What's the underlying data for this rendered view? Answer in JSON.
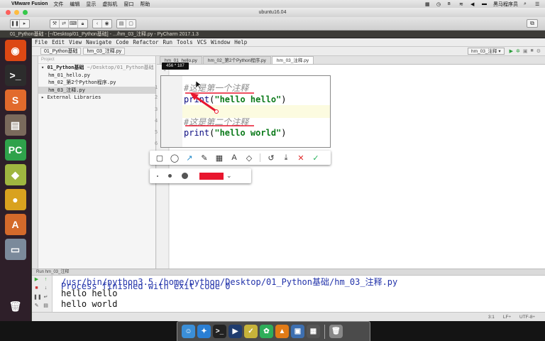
{
  "mac_menubar": {
    "app_name": "VMware Fusion",
    "menus": [
      "文件",
      "编辑",
      "显示",
      "虚拟机",
      "窗口",
      "帮助"
    ],
    "user_name": "黑马程序员"
  },
  "vm_window": {
    "title": "ubuntu16.04"
  },
  "ubuntu": {
    "window_title": "01_Python基础 - [~/Desktop/01_Python基础] - .../hm_03_注释.py - PyCharm 2017.1.3",
    "launcher": [
      {
        "name": "ubuntu-dash",
        "glyph": "◉",
        "color": "#dd4814"
      },
      {
        "name": "terminal",
        "glyph": ">_",
        "color": "#2c2c2c"
      },
      {
        "name": "sublime",
        "glyph": "S",
        "color": "#e26a2c"
      },
      {
        "name": "files",
        "glyph": "▤",
        "color": "#7a6a5c"
      },
      {
        "name": "pycharm",
        "glyph": "PC",
        "color": "#2fa24b"
      },
      {
        "name": "cube",
        "glyph": "◆",
        "color": "#9fb640"
      },
      {
        "name": "chrome",
        "glyph": "●",
        "color": "#d9a21f"
      },
      {
        "name": "text",
        "glyph": "A",
        "color": "#d46a2b"
      },
      {
        "name": "storage",
        "glyph": "▭",
        "color": "#7b8a9b"
      }
    ],
    "trash_glyph": "🗑"
  },
  "pycharm": {
    "menu": [
      "File",
      "Edit",
      "View",
      "Navigate",
      "Code",
      "Refactor",
      "Run",
      "Tools",
      "VCS",
      "Window",
      "Help"
    ],
    "breadcrumbs": [
      "01_Python基础",
      "hm_03_注释.py"
    ],
    "run_config": "hm_03_注释 ▾",
    "project_header": "Project",
    "tree": [
      {
        "label": "01_Python基础",
        "path": " ~/Desktop/01_Python基础"
      },
      {
        "label": "hm_01_hello.py",
        "path": ""
      },
      {
        "label": "hm_02_第2个Python程序.py",
        "path": ""
      },
      {
        "label": "hm_03_注释.py",
        "path": ""
      },
      {
        "label": "External Libraries",
        "path": ""
      }
    ],
    "tabs": [
      "hm_01_hello.py",
      "hm_02_第2个Python程序.py",
      "hm_03_注释.py"
    ],
    "line_numbers": [
      "1",
      "2",
      "3",
      "4",
      "5",
      "6"
    ],
    "run_header": "Run   hm_03_注释",
    "console": {
      "command": "/usr/bin/python3.5 /home/python/Desktop/01_Python基础/hm_03_注释.py",
      "out1": "hello hello",
      "out2": "hello world",
      "exit": "Process finished with exit code 0"
    },
    "status": {
      "position": "3:1",
      "separator": "LF÷",
      "encoding": "UTF-8÷"
    }
  },
  "overlay": {
    "size_label": "456 * 187",
    "code": {
      "comment1": "#这是第一个注释",
      "line2_fn": "print",
      "line2_arg": "\"hello hello\"",
      "comment2": "#这是第二个注释",
      "line5_fn": "print",
      "line5_arg": "\"hello world\""
    },
    "annotation_color": "#e8162e"
  },
  "dock": {
    "apps": [
      {
        "name": "finder",
        "glyph": "☺",
        "color": "#3b8fd8"
      },
      {
        "name": "safari",
        "glyph": "✦",
        "color": "#2a7fd4"
      },
      {
        "name": "terminal",
        "glyph": ">_",
        "color": "#222"
      },
      {
        "name": "quicktime",
        "glyph": "▶",
        "color": "#1f3c6e"
      },
      {
        "name": "notes",
        "glyph": "✓",
        "color": "#c7b33a"
      },
      {
        "name": "clover",
        "glyph": "✿",
        "color": "#2fae5a"
      },
      {
        "name": "vlc",
        "glyph": "▲",
        "color": "#e27b16"
      },
      {
        "name": "vmware",
        "glyph": "▣",
        "color": "#3d6fb0"
      },
      {
        "name": "screenshot",
        "glyph": "▦",
        "color": "#555"
      }
    ],
    "trash_glyph": "🗑"
  }
}
